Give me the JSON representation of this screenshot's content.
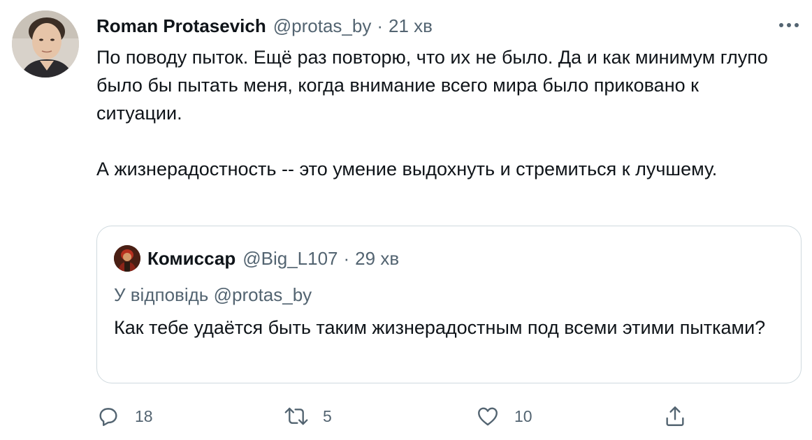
{
  "tweet": {
    "author": {
      "display_name": "Roman Protasevich",
      "handle": "@protas_by",
      "separator": "·",
      "time": "21 хв"
    },
    "more_icon": "more-horizontal-icon",
    "paragraphs": [
      "По поводу пыток. Ещё раз повторю, что их не было. Да и как минимум глупо было бы пытать меня, когда внимание всего мира было приковано к ситуации.",
      "А жизнерадостность -- это умение выдохнуть и стремиться к лучшему."
    ],
    "quoted": {
      "display_name": "Комиссар",
      "handle": "@Big_L107",
      "separator": "·",
      "time": "29 хв",
      "reply_prefix": "У відповідь",
      "reply_handle": "@protas_by",
      "text": "Как тебе удаётся быть таким жизнерадостным под всеми этими пытками?"
    },
    "actions": {
      "reply": {
        "icon": "reply-bubble-icon",
        "count": "18"
      },
      "retweet": {
        "icon": "retweet-icon",
        "count": "5"
      },
      "like": {
        "icon": "heart-icon",
        "count": "10"
      },
      "share": {
        "icon": "share-upload-icon"
      }
    }
  },
  "colors": {
    "text_primary": "#0f1419",
    "text_secondary": "#536471",
    "border": "#cfd9de",
    "background": "#ffffff"
  }
}
